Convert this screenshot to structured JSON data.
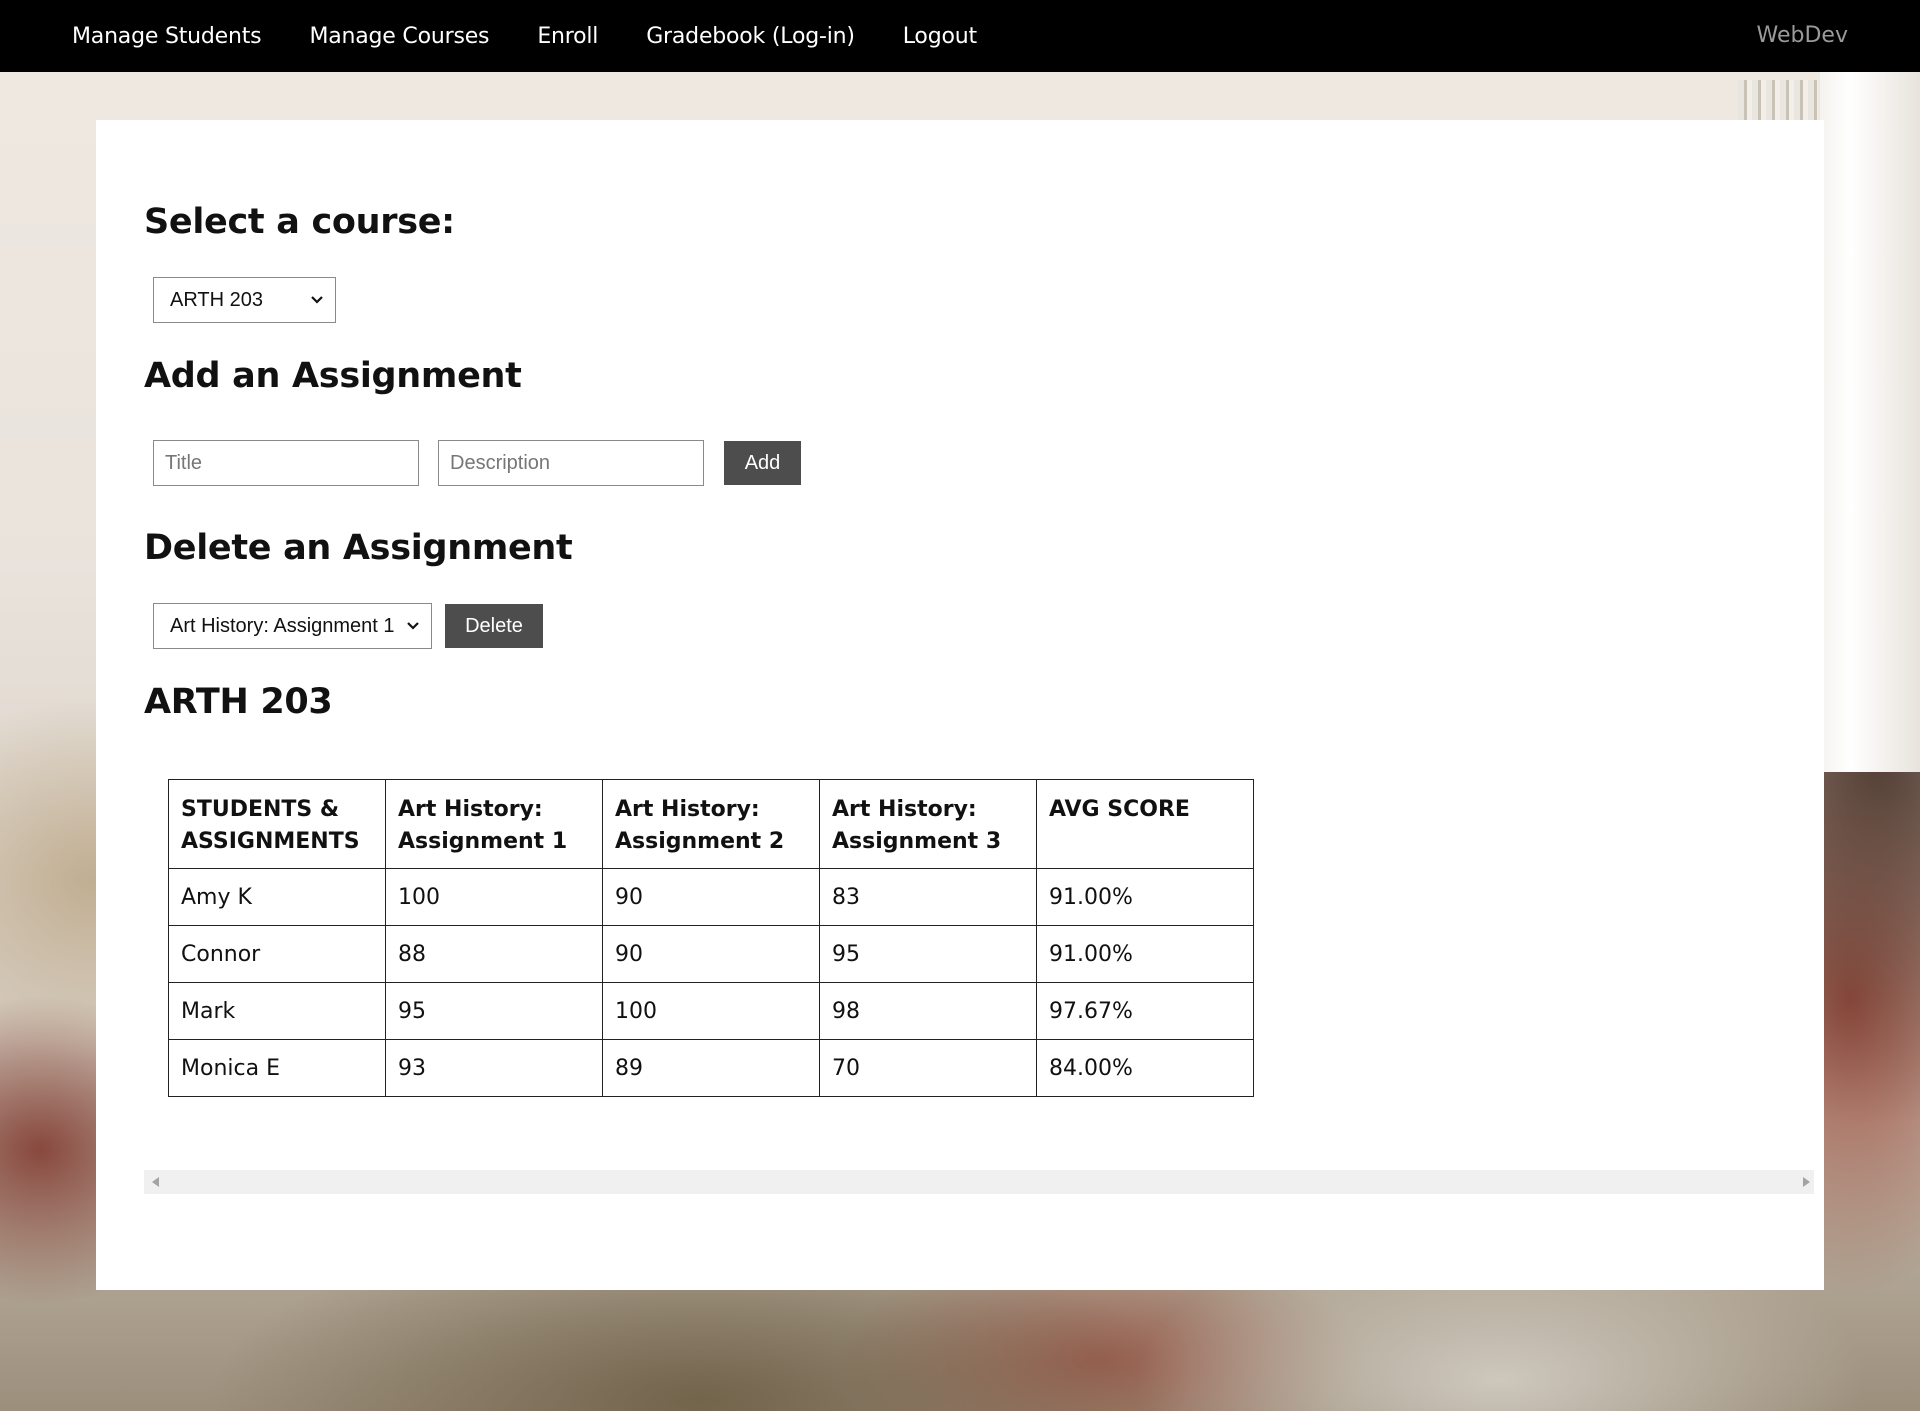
{
  "nav": {
    "links": [
      "Manage Students",
      "Manage Courses",
      "Enroll",
      "Gradebook (Log-in)",
      "Logout"
    ],
    "brand": "WebDev"
  },
  "select_course": {
    "heading": "Select a course:",
    "selected": "ARTH 203"
  },
  "add_assignment": {
    "heading": "Add an Assignment",
    "title_placeholder": "Title",
    "title_value": "",
    "description_placeholder": "Description",
    "description_value": "",
    "add_label": "Add"
  },
  "delete_assignment": {
    "heading": "Delete an Assignment",
    "selected": "Art History: Assignment 1",
    "delete_label": "Delete"
  },
  "course_table": {
    "heading": "ARTH 203",
    "columns": [
      [
        "STUDENTS &",
        "ASSIGNMENTS"
      ],
      [
        "Art History:",
        "Assignment 1"
      ],
      [
        "Art History:",
        "Assignment 2"
      ],
      [
        "Art History:",
        "Assignment 3"
      ],
      [
        "AVG SCORE",
        ""
      ]
    ],
    "rows": [
      [
        "Amy K",
        "100",
        "90",
        "83",
        "91.00%"
      ],
      [
        "Connor",
        "88",
        "90",
        "95",
        "91.00%"
      ],
      [
        "Mark",
        "95",
        "100",
        "98",
        "97.67%"
      ],
      [
        "Monica E",
        "93",
        "89",
        "70",
        "84.00%"
      ]
    ]
  },
  "colors": {
    "navbar": "#000000",
    "button": "#4d4d4d",
    "card": "#ffffff",
    "brand_text": "#9a9a9a"
  },
  "icons": [
    "chevron-down-icon",
    "scroll-left-arrow-icon",
    "scroll-right-arrow-icon"
  ]
}
